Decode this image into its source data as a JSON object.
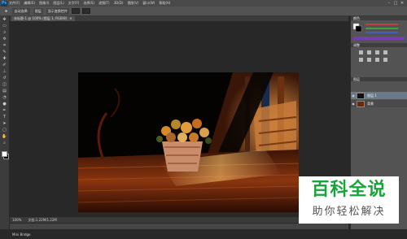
{
  "app": {
    "logo_text": "Ps"
  },
  "menu": {
    "items": [
      "文件(F)",
      "编辑(E)",
      "图像(I)",
      "图层(L)",
      "文字(Y)",
      "选择(S)",
      "滤镜(T)",
      "3D(D)",
      "视图(V)",
      "窗口(W)",
      "帮助(H)"
    ]
  },
  "window_controls": {
    "minimize": "–",
    "maximize": "□",
    "close": "✕"
  },
  "options": {
    "auto_select": "自动选择:",
    "layer": "图层",
    "transform": "显示变换控件"
  },
  "document": {
    "tab_title": "未标题-1 @ 100% (图层 1, RGB/8)",
    "tab_close": "×"
  },
  "status": {
    "zoom": "100%",
    "doc_size": "文档:1.22M/1.22M"
  },
  "bottom_dock": {
    "tab": "Mini Bridge"
  },
  "panels": {
    "color_tab": "颜色",
    "adjust_tab": "调整",
    "layers_tab": "图层",
    "layers": [
      {
        "name": "图层 1"
      },
      {
        "name": "背景"
      }
    ]
  },
  "watermark": {
    "title": "百科全说",
    "subtitle": "助你轻松解决"
  },
  "colors": {
    "watermark_green": "#19a33b",
    "ui_dark": "#282828",
    "panel": "#535353"
  }
}
